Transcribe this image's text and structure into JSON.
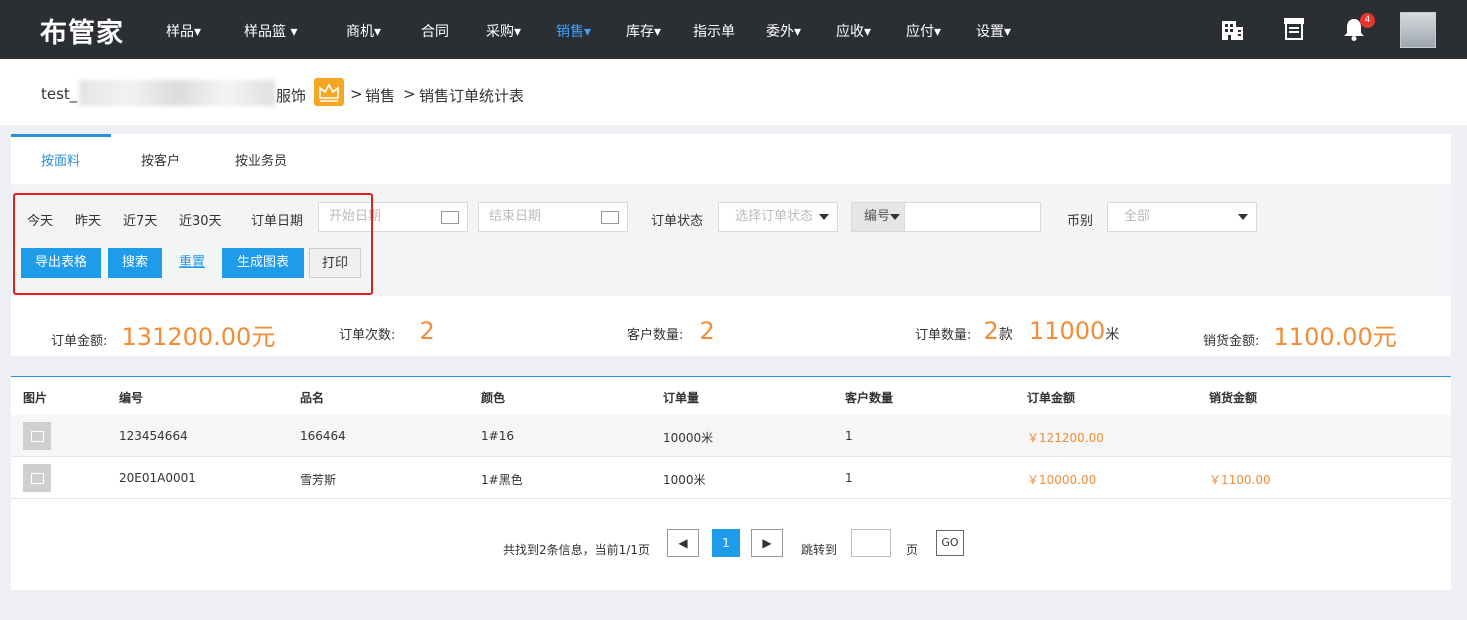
{
  "nav": {
    "logo": "布管家",
    "items": [
      "样品▾",
      "样品篮 ▾",
      "商机▾",
      "合同",
      "采购▾",
      "销售▾",
      "库存▾",
      "指示单",
      "委外▾",
      "应收▾",
      "应付▾",
      "设置▾"
    ],
    "active": "销售▾",
    "icons": [
      "building-icon",
      "store-icon",
      "bell-icon"
    ],
    "notification_count": "4"
  },
  "breadcrumb": {
    "company_prefix": "test_",
    "company_suffix": "服饰",
    "sep1": ">",
    "level1": "销售",
    "sep2": ">",
    "level2": "销售订单统计表"
  },
  "tabs": [
    "按面料",
    "按客户",
    "按业务员"
  ],
  "filters": {
    "quick": [
      "今天",
      "昨天",
      "近7天",
      "近30天"
    ],
    "order_date_label": "订单日期",
    "start_placeholder": "开始日期",
    "end_placeholder": "结束日期",
    "status_label": "订单状态",
    "status_placeholder": "选择订单状态",
    "code_select": "编号",
    "currency_label": "币别",
    "currency_value": "全部"
  },
  "buttons": {
    "export": "导出表格",
    "search": "搜索",
    "reset": "重置",
    "chart": "生成图表",
    "print": "打印"
  },
  "stats": {
    "order_amount_label": "订单金额:",
    "order_amount": "131200.00",
    "order_amount_unit": "元",
    "order_count_label": "订单次数:",
    "order_count": "2",
    "customer_count_label": "客户数量:",
    "customer_count": "2",
    "order_qty_label": "订单数量:",
    "order_qty_items": "2",
    "order_qty_items_unit": "款",
    "order_qty_meters": "11000",
    "order_qty_meters_unit": "米",
    "sales_amount_label": "销货金额:",
    "sales_amount": "1100.00",
    "sales_amount_unit": "元"
  },
  "table": {
    "headers": [
      "图片",
      "编号",
      "品名",
      "颜色",
      "订单量",
      "客户数量",
      "订单金额",
      "销货金额"
    ],
    "rows": [
      {
        "code": "123454664",
        "name": "166464",
        "color": "1#16",
        "qty": "10000米",
        "customers": "1",
        "amount": "￥121200.00",
        "sales": ""
      },
      {
        "code": "20E01A0001",
        "name": "雪芳斯",
        "color": "1#黑色",
        "qty": "1000米",
        "customers": "1",
        "amount": "￥10000.00",
        "sales": "￥1100.00"
      }
    ]
  },
  "pager": {
    "info": "共找到2条信息，当前1/1页",
    "prev": "◀",
    "current": "1",
    "next": "▶",
    "jump_label": "跳转到",
    "page_unit": "页",
    "go": "GO"
  }
}
